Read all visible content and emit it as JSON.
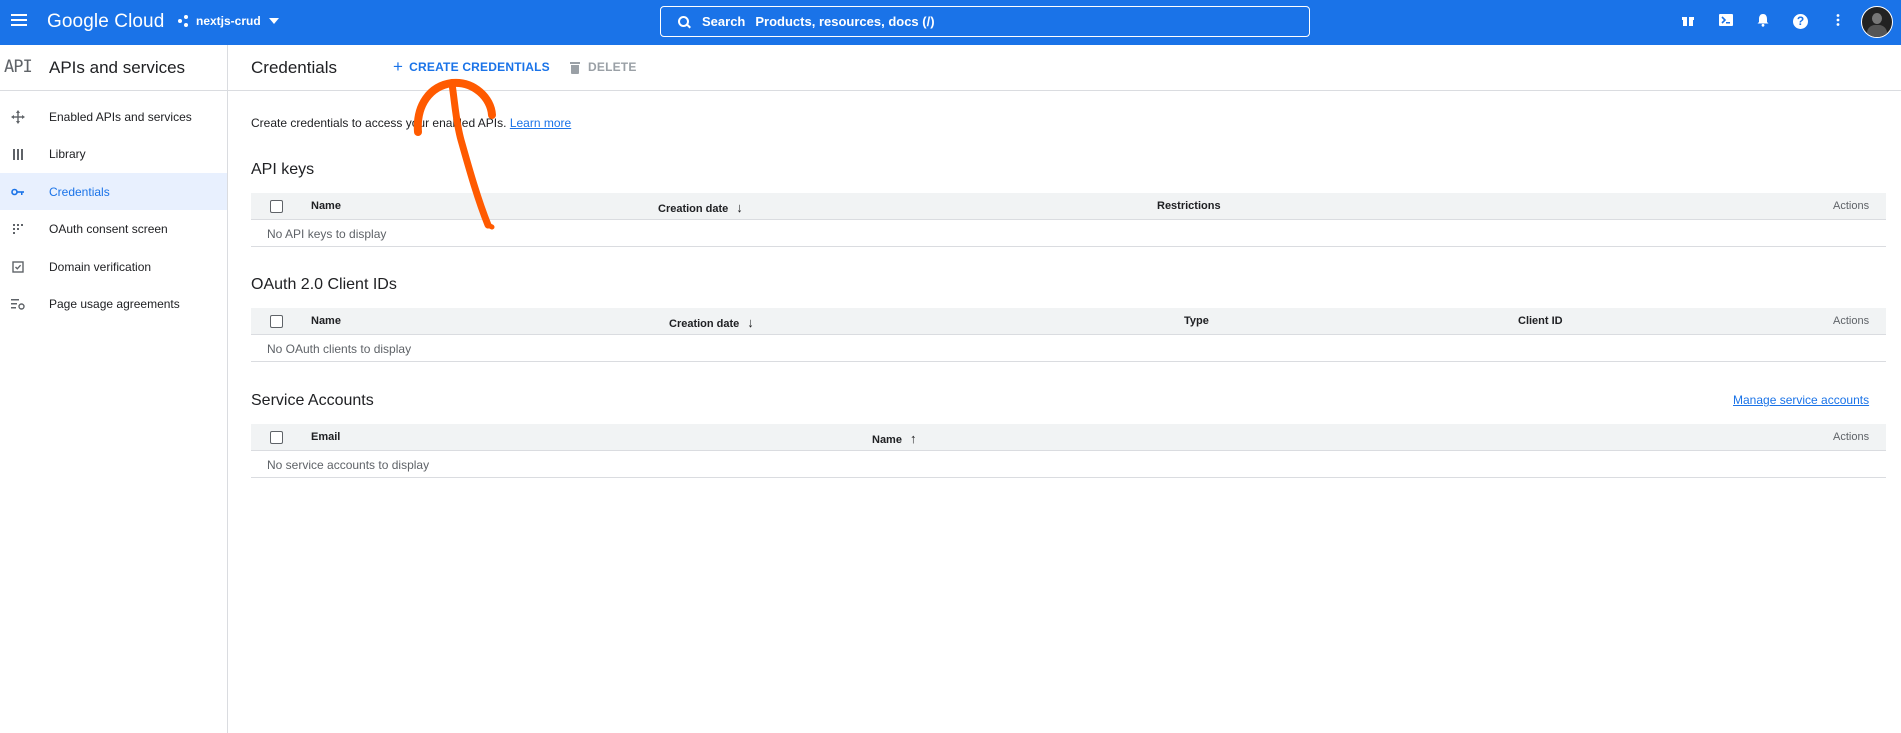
{
  "topbar": {
    "logo": "Google Cloud",
    "project": "nextjs-crud",
    "search_label": "Search",
    "search_placeholder": "Products, resources, docs (/)"
  },
  "sidebar": {
    "badge": "API",
    "title": "APIs and services",
    "items": [
      {
        "label": "Enabled APIs and services"
      },
      {
        "label": "Library"
      },
      {
        "label": "Credentials",
        "active": true
      },
      {
        "label": "OAuth consent screen"
      },
      {
        "label": "Domain verification"
      },
      {
        "label": "Page usage agreements"
      }
    ]
  },
  "main": {
    "title": "Credentials",
    "create_label": "CREATE CREDENTIALS",
    "delete_label": "DELETE",
    "intro": "Create credentials to access your enabled APIs.",
    "learn_more": "Learn more",
    "api_keys": {
      "title": "API keys",
      "columns": [
        "Name",
        "Creation date",
        "Restrictions",
        "Actions"
      ],
      "empty": "No API keys to display"
    },
    "oauth": {
      "title": "OAuth 2.0 Client IDs",
      "columns": [
        "Name",
        "Creation date",
        "Type",
        "Client ID",
        "Actions"
      ],
      "empty": "No OAuth clients to display"
    },
    "service_accounts": {
      "title": "Service Accounts",
      "manage": "Manage service accounts",
      "columns": [
        "Email",
        "Name",
        "Actions"
      ],
      "empty": "No service accounts to display"
    }
  },
  "colors": {
    "brand": "#1a73e8",
    "annotation": "#ff5a00"
  }
}
